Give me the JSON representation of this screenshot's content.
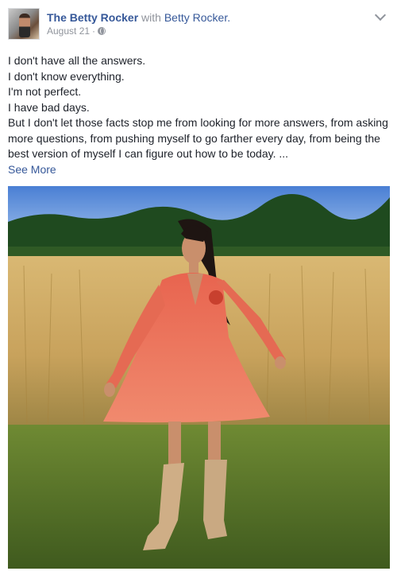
{
  "post": {
    "page_name": "The Betty Rocker",
    "with_text": "with",
    "tagged_name": "Betty Rocker.",
    "date": "August 21",
    "dot": "·",
    "privacy_icon": "globe-icon",
    "menu_icon": "chevron-down-icon",
    "lines": [
      "I don't have all the answers.",
      "I don't know everything.",
      "I'm not perfect.",
      "I have bad days.",
      "But I don't let those facts stop me from looking for more answers, from asking more questions, from pushing myself to go farther every day, from being the best version of myself I can figure out how to be today. ..."
    ],
    "see_more": "See More"
  },
  "colors": {
    "link": "#365899",
    "secondary_text": "#90949c",
    "body_text": "#1d2129",
    "dress": "#e8644f"
  }
}
